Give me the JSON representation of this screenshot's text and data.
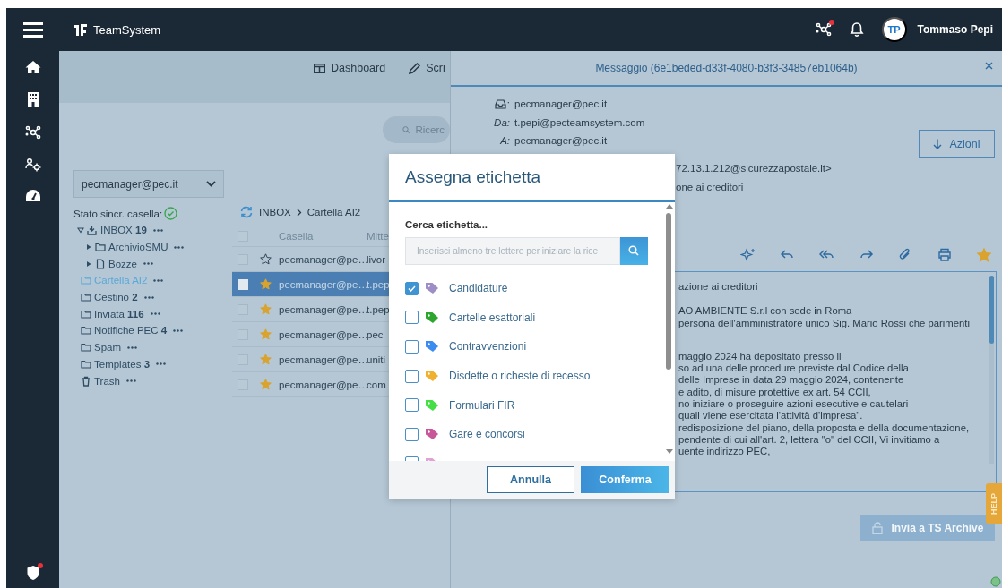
{
  "topbar": {
    "brand": "TeamSystem",
    "avatar_initials": "TP",
    "user_name": "Tommaso Pepi"
  },
  "nav": [
    {
      "kind": "dashboard",
      "label": "Dashboard"
    },
    {
      "kind": "pencil",
      "label": "Scri"
    }
  ],
  "search": {
    "placeholder": "Ricerc"
  },
  "account_select": {
    "value": "pecmanager@pec.it"
  },
  "sync_status": {
    "label": "Stato sincr. casella:",
    "ok": true
  },
  "folders": [
    {
      "kind": "inbox",
      "name": "INBOX",
      "count": "19",
      "collapsible": true,
      "expanded": true,
      "selected": false,
      "children": [
        {
          "kind": "folder",
          "name": "ArchivioSMU",
          "collapsible": true,
          "expanded": false,
          "selected": false
        },
        {
          "kind": "draft",
          "name": "Bozze",
          "collapsible": true,
          "expanded": false,
          "selected": false
        }
      ]
    },
    {
      "kind": "folder",
      "name": "Cartella AI2",
      "collapsible": false,
      "expanded": false,
      "selected": true
    },
    {
      "kind": "folder",
      "name": "Cestino",
      "count": "2",
      "collapsible": false,
      "expanded": false,
      "selected": false
    },
    {
      "kind": "folder",
      "name": "Inviata",
      "count": "116",
      "collapsible": false,
      "expanded": false,
      "selected": false
    },
    {
      "kind": "folder",
      "name": "Notifiche PEC",
      "count": "4",
      "collapsible": false,
      "expanded": false,
      "selected": false
    },
    {
      "kind": "folder",
      "name": "Spam",
      "collapsible": false,
      "expanded": false,
      "selected": false
    },
    {
      "kind": "folder",
      "name": "Templates",
      "count": "3",
      "collapsible": false,
      "expanded": false,
      "selected": false
    },
    {
      "kind": "trash",
      "name": "Trash",
      "collapsible": false,
      "expanded": false,
      "selected": false
    }
  ],
  "breadcrumb": [
    "INBOX",
    "Cartella AI2"
  ],
  "mail_table": {
    "select_all_checked": false,
    "columns": [
      "Casella",
      "Mitte"
    ],
    "rows": [
      {
        "selected": false,
        "checked": false,
        "starred": false,
        "cells": [
          "pecmanager@pe…",
          "livor"
        ]
      },
      {
        "selected": true,
        "checked": false,
        "starred": true,
        "cells": [
          "pecmanager@pe…",
          "t.pep"
        ]
      },
      {
        "selected": false,
        "checked": false,
        "starred": true,
        "cells": [
          "pecmanager@pe…",
          "t.pep"
        ]
      },
      {
        "selected": false,
        "checked": false,
        "starred": true,
        "cells": [
          "pecmanager@pe…",
          "pec"
        ]
      },
      {
        "selected": false,
        "checked": false,
        "starred": true,
        "cells": [
          "pecmanager@pe…",
          "uniti"
        ]
      },
      {
        "selected": false,
        "checked": false,
        "starred": true,
        "cells": [
          "pecmanager@pe…",
          "com"
        ]
      }
    ]
  },
  "message": {
    "title": "Messaggio (6e1beded-d33f-4080-b3f3-34857eb1064b)",
    "fields": [
      {
        "kind": "mailbox",
        "label": ":",
        "value": "pecmanager@pec.it"
      },
      {
        "kind": "text",
        "label": "Da:",
        "value": "t.pepi@pecteamsystem.com"
      },
      {
        "kind": "text",
        "label": "A:",
        "value": "pecmanager@pec.it"
      }
    ],
    "actions_button": "Azioni",
    "partial_fields": [
      "72.13.1.212@sicurezzapostale.it>",
      "one ai creditori"
    ],
    "toolbar": [
      {
        "kind": "sparkle"
      },
      {
        "kind": "reply"
      },
      {
        "kind": "reply-all"
      },
      {
        "kind": "forward"
      },
      {
        "kind": "attach"
      },
      {
        "kind": "print"
      },
      {
        "kind": "star"
      }
    ],
    "starred": true,
    "body_paragraphs": [
      [
        "azione ai creditori"
      ],
      [
        "AO AMBIENTE S.r.l con sede in Roma",
        "persona dell'amministratore unico Sig. Mario Rossi che parimenti"
      ],
      [
        "maggio 2024 ha depositato presso il",
        "so ad una delle procedure previste dal Codice della",
        "delle Imprese in data 29 maggio 2024, contenente",
        "e adito, di misure protettive ex art. 54 CCII,",
        "no iniziare o proseguire azioni esecutive e cautelari",
        "quali viene esercitata l'attività d'impresa\".",
        "redisposizione del piano, della proposta e della documentazione,",
        "pendente di cui all'art. 2, lettera \"o\" del CCII, Vi invitiamo a",
        "uente indirizzo PEC,"
      ]
    ],
    "archive_button": {
      "label": "Invia a TS Archive",
      "disabled": true
    }
  },
  "help_tab": "HELP",
  "dialog": {
    "title": "Assegna etichetta",
    "search_label": "Cerca etichetta...",
    "search_placeholder": "Inserisci almeno tre lettere per iniziare la rice",
    "labels": [
      {
        "name": "Candidature",
        "checked": true,
        "color": "#9d8fc6"
      },
      {
        "name": "Cartelle esattoriali",
        "checked": false,
        "color": "#2ea52e"
      },
      {
        "name": "Contravvenzioni",
        "checked": false,
        "color": "#3b8cf0"
      },
      {
        "name": "Disdette o richeste di recesso",
        "checked": false,
        "color": "#f0b22e"
      },
      {
        "name": "Formulari FIR",
        "checked": false,
        "color": "#45de45"
      },
      {
        "name": "Gare e concorsi",
        "checked": false,
        "color": "#c8579a"
      },
      {
        "checked": false,
        "color": "#dfa2d3"
      }
    ],
    "cancel": "Annulla",
    "confirm": "Conferma"
  }
}
